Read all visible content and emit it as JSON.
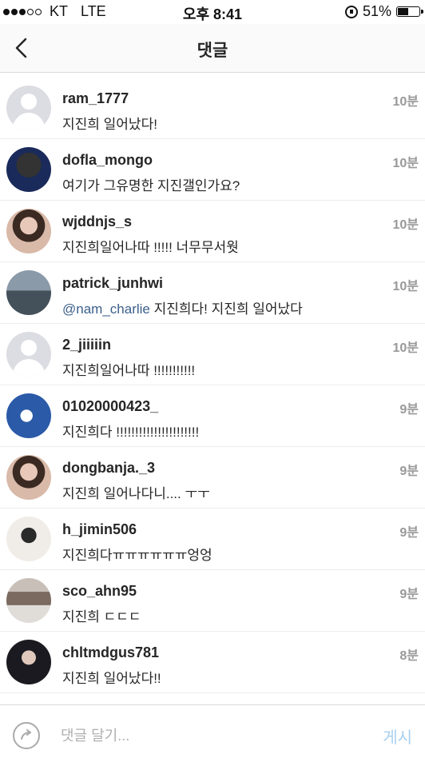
{
  "status": {
    "carrier": "KT",
    "network": "LTE",
    "time": "오후 8:41",
    "battery": "51%",
    "battery_level": 0.51
  },
  "header": {
    "title": "댓글"
  },
  "comments": [
    {
      "username": "ram_1777",
      "text": "지진희 일어났다!",
      "time": "10분",
      "avatar": "placeholder"
    },
    {
      "username": "dofla_mongo",
      "text": "여기가 그유명한 지진갤인가요?",
      "time": "10분",
      "avatar": "dark"
    },
    {
      "username": "wjddnjs_s",
      "text": "지진희일어나따 !!!!! 너무무서웟",
      "time": "10분",
      "avatar": "portrait"
    },
    {
      "username": "patrick_junhwi",
      "mention": "@nam_charlie",
      "text": " 지진희다! 지진희 일어났다",
      "time": "10분",
      "avatar": "city"
    },
    {
      "username": "2_jiiiiin",
      "text": "지진희일어나따 !!!!!!!!!!!",
      "time": "10분",
      "avatar": "placeholder"
    },
    {
      "username": "01020000423_",
      "text": "지진희다 !!!!!!!!!!!!!!!!!!!!!!",
      "time": "9분",
      "avatar": "blue"
    },
    {
      "username": "dongbanja._3",
      "text": "지진희 일어나다니.... ㅜㅜ",
      "time": "9분",
      "avatar": "portrait"
    },
    {
      "username": "h_jimin506",
      "text": "지진희다ㅠㅠㅠㅠㅠㅠ엉엉",
      "time": "9분",
      "avatar": "light"
    },
    {
      "username": "sco_ahn95",
      "text": "지진희 ㄷㄷㄷ",
      "time": "9분",
      "avatar": "building"
    },
    {
      "username": "chltmdgus781",
      "text": "지진희 일어났다!!",
      "time": "8분",
      "avatar": "portrait-dark"
    }
  ],
  "composer": {
    "placeholder": "댓글 달기...",
    "post_label": "게시"
  },
  "colors": {
    "mention": "#3b5f8a",
    "post_button": "#a8d0f0",
    "time": "#999999"
  }
}
